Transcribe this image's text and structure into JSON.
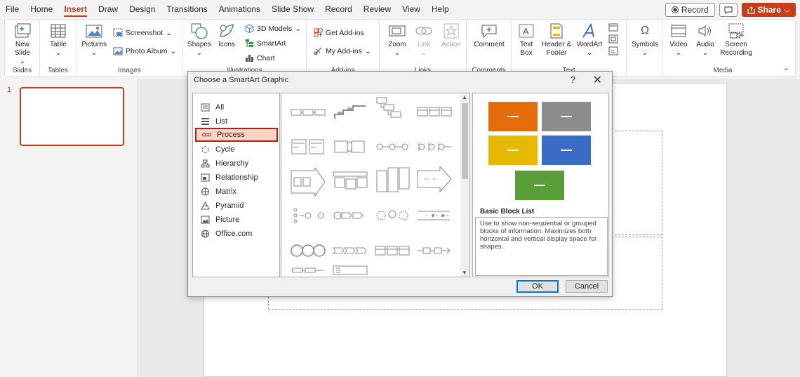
{
  "menu": {
    "tabs": [
      "File",
      "Home",
      "Insert",
      "Draw",
      "Design",
      "Transitions",
      "Animations",
      "Slide Show",
      "Record",
      "Review",
      "View",
      "Help"
    ],
    "active_tab": "Insert",
    "record_label": "Record",
    "share_label": "Share"
  },
  "ribbon": {
    "groups": {
      "slides": "Slides",
      "tables": "Tables",
      "images": "Images",
      "illustrations": "Illustrations",
      "addins": "Add-ins",
      "links": "Links",
      "comments": "Comments",
      "text": "Text",
      "media": "Media"
    },
    "buttons": {
      "new_slide": "New Slide",
      "table": "Table",
      "pictures": "Pictures",
      "screenshot": "Screenshot",
      "photo_album": "Photo Album",
      "shapes": "Shapes",
      "icons": "Icons",
      "models_3d": "3D Models",
      "smartart": "SmartArt",
      "chart": "Chart",
      "get_addins": "Get Add-ins",
      "my_addins": "My Add-ins",
      "zoom": "Zoom",
      "link": "Link",
      "action": "Action",
      "comment": "Comment",
      "text_box": "Text Box",
      "header_footer": "Header & Footer",
      "wordart": "WordArt",
      "symbols": "Symbols",
      "video": "Video",
      "audio": "Audio",
      "screen_recording": "Screen Recording"
    }
  },
  "slides": {
    "current_number": "1"
  },
  "dialog": {
    "title": "Choose a SmartArt Graphic",
    "help": "?",
    "close": "✕",
    "categories": [
      "All",
      "List",
      "Process",
      "Cycle",
      "Hierarchy",
      "Relationship",
      "Matrix",
      "Pyramid",
      "Picture",
      "Office.com"
    ],
    "selected_category": "Process",
    "preview_title": "Basic Block List",
    "preview_description": "Use to show non-sequential or grouped blocks of information. Maximizes both horizontal and vertical display space for shapes.",
    "ok_label": "OK",
    "cancel_label": "Cancel"
  },
  "colors": {
    "accent": "#c43e1c",
    "selected_fill": "#fdd3c1",
    "selected_border": "#b71c1c",
    "preview_orange": "#e46c0a",
    "preview_gray": "#8c8c8c",
    "preview_gold": "#e6b800",
    "preview_blue": "#3a6cc5",
    "preview_green": "#5a9e3a"
  }
}
